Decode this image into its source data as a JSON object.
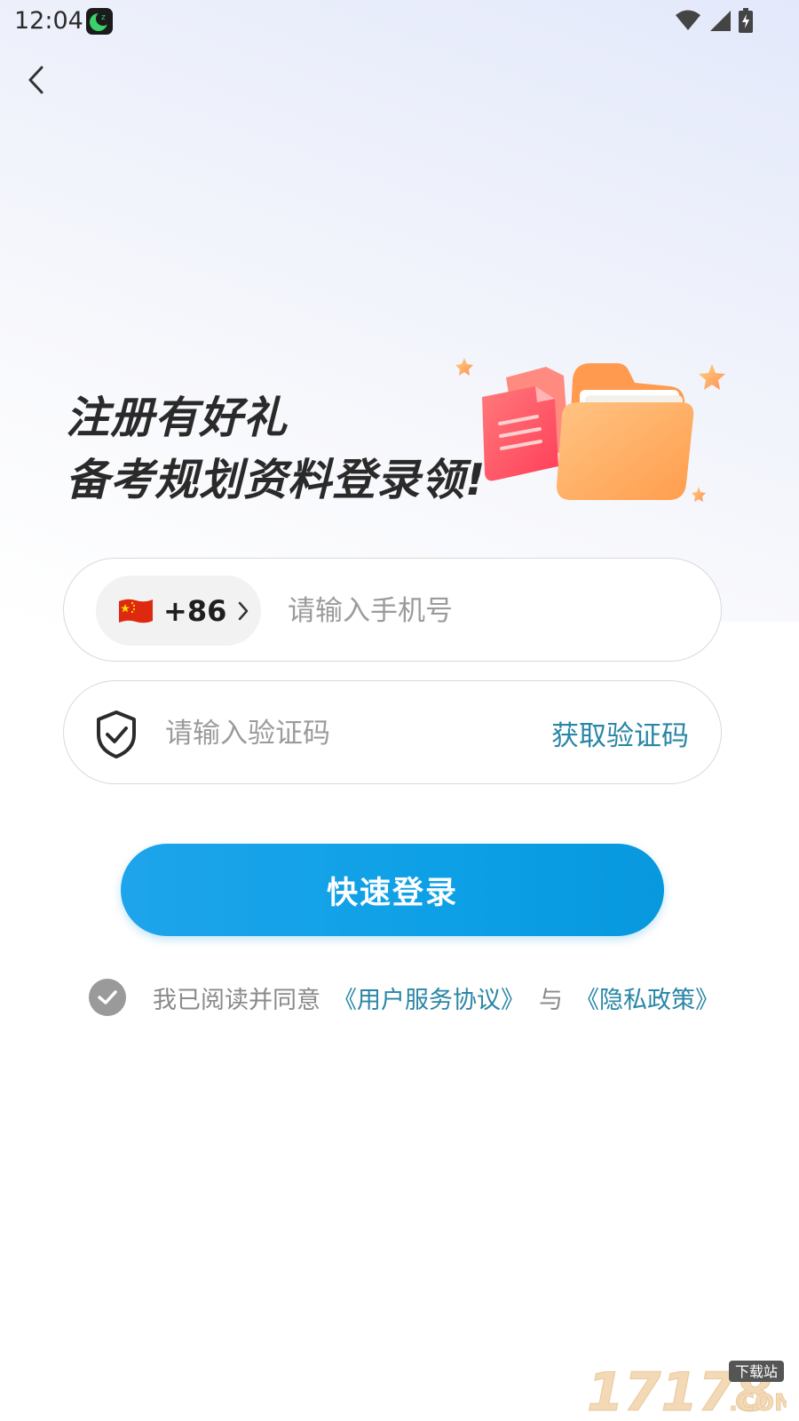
{
  "status_bar": {
    "time": "12:04",
    "icons": [
      "app-notification-icon",
      "wifi-icon",
      "signal-icon",
      "battery-charging-icon"
    ]
  },
  "nav": {
    "back_icon": "chevron-left-icon"
  },
  "promo": {
    "line1": "注册有好礼",
    "line2": "备考规划资料登录领!",
    "illustration": "document-folder-illustration"
  },
  "phone_field": {
    "country_flag": "china-flag-icon",
    "country_code": "+86",
    "value": "",
    "placeholder": "请输入手机号"
  },
  "code_field": {
    "icon": "shield-check-icon",
    "value": "",
    "placeholder": "请输入验证码",
    "get_code_label": "获取验证码"
  },
  "login_button": {
    "label": "快速登录"
  },
  "agreement": {
    "checked": true,
    "prefix": "我已阅读并同意",
    "user_agreement": "《用户服务协议》",
    "conjunction": "与",
    "privacy_policy": "《隐私政策》"
  },
  "watermark": {
    "number": "17178",
    "suffix": ".COM",
    "tag": "下载站"
  },
  "colors": {
    "accent_blue": "#0da0e6",
    "link_teal": "#2a86a6",
    "headline": "#2a2a2a"
  }
}
